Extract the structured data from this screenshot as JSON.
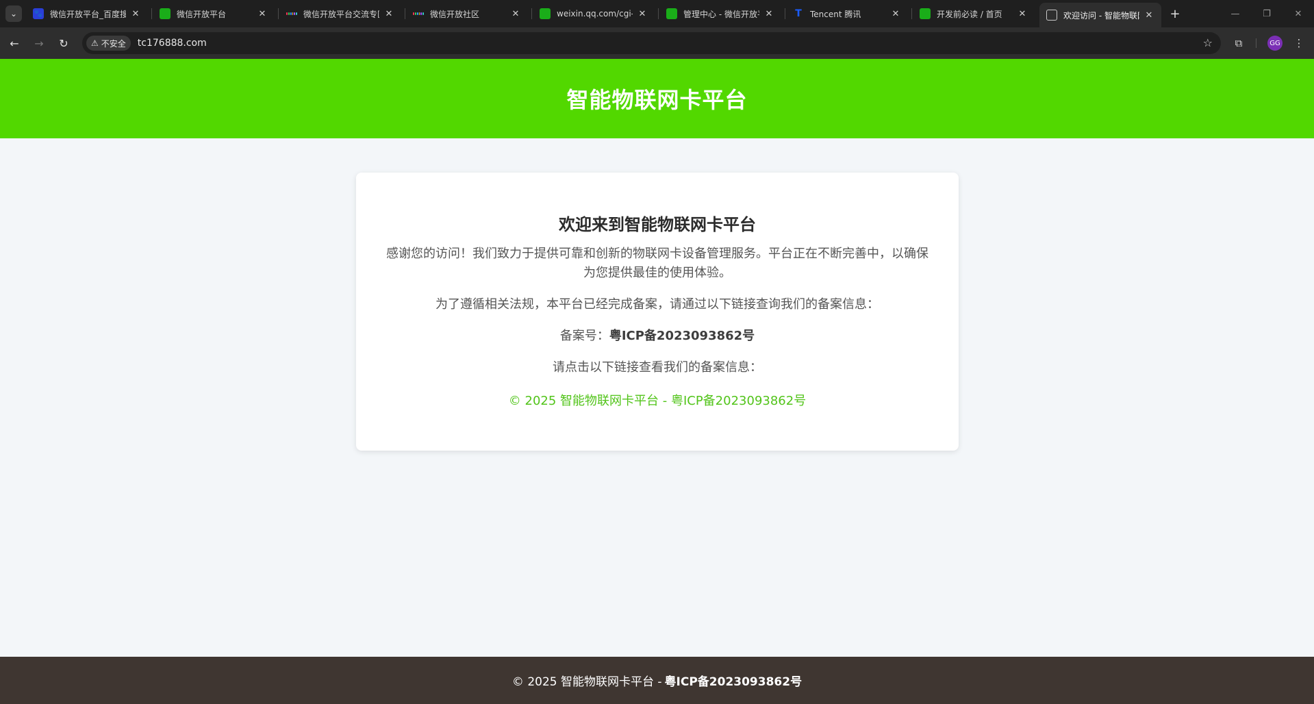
{
  "browser": {
    "tabs": [
      {
        "title": "微信开放平台_百度搜",
        "favicon": "baidu-paw-icon",
        "active": false
      },
      {
        "title": "微信开放平台",
        "favicon": "wechat-icon",
        "active": false
      },
      {
        "title": "微信开放平台交流专区",
        "favicon": "grid-icon",
        "active": false
      },
      {
        "title": "微信开放社区",
        "favicon": "grid-icon",
        "active": false
      },
      {
        "title": "weixin.qq.com/cgi-b",
        "favicon": "wechat-icon",
        "active": false
      },
      {
        "title": "管理中心 - 微信开放平",
        "favicon": "wechat-icon",
        "active": false
      },
      {
        "title": "Tencent 腾讯",
        "favicon": "tencent-icon",
        "active": false
      },
      {
        "title": "开发前必读 / 首页",
        "favicon": "wechat-icon",
        "active": false
      },
      {
        "title": "欢迎访问 - 智能物联网",
        "favicon": "globe-icon",
        "active": true
      }
    ],
    "security_label": "不安全",
    "url": "tc176888.com",
    "profile_initials": "GG"
  },
  "header": {
    "title": "智能物联网卡平台"
  },
  "card": {
    "heading": "欢迎来到智能物联网卡平台",
    "intro": "感谢您的访问！我们致力于提供可靠和创新的物联网卡设备管理服务。平台正在不断完善中，以确保为您提供最佳的使用体验。",
    "compliance": "为了遵循相关法规，本平台已经完成备案，请通过以下链接查询我们的备案信息：",
    "icp_label": "备案号：",
    "icp_number": "粤ICP备2023093862号",
    "link_prompt": "请点击以下链接查看我们的备案信息：",
    "icp_link": "© 2025 智能物联网卡平台 - 粤ICP备2023093862号"
  },
  "footer": {
    "prefix": "© 2025 智能物联网卡平台 -",
    "icp": "粤ICP备2023093862号"
  },
  "colors": {
    "header_green": "#52d800",
    "link_green": "#52c41a",
    "footer_brown": "#3f3631"
  }
}
